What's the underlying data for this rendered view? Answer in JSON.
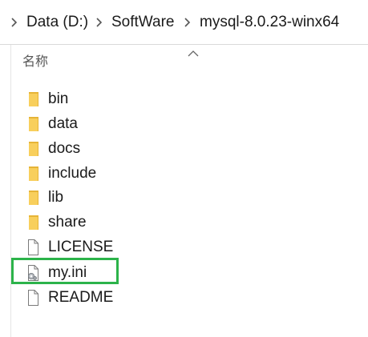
{
  "breadcrumb": {
    "items": [
      "‹",
      "Data (D:)",
      "SoftWare",
      "mysql-8.0.23-winx64"
    ]
  },
  "file_list": {
    "column_header": "名称",
    "items": [
      {
        "name": "bin",
        "type": "folder"
      },
      {
        "name": "data",
        "type": "folder"
      },
      {
        "name": "docs",
        "type": "folder"
      },
      {
        "name": "include",
        "type": "folder"
      },
      {
        "name": "lib",
        "type": "folder"
      },
      {
        "name": "share",
        "type": "folder"
      },
      {
        "name": "LICENSE",
        "type": "file"
      },
      {
        "name": "my.ini",
        "type": "config-file",
        "highlighted": true
      },
      {
        "name": "README",
        "type": "file"
      }
    ]
  },
  "colors": {
    "folder": "#f8cf5c",
    "folder_dark": "#e6b437",
    "highlight": "#2cb34a",
    "text": "#1a1a1a"
  }
}
